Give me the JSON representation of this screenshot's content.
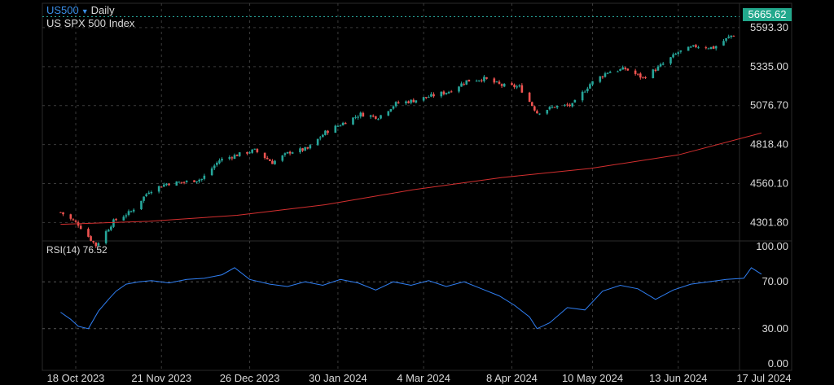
{
  "header": {
    "symbol": "US500",
    "interval": "Daily",
    "instrument_name": "US SPX 500 Index",
    "last_price": "5665.62"
  },
  "colors": {
    "background": "#000000",
    "up_candle": "#26a69a",
    "down_candle": "#ef5350",
    "moving_average": "#d32f2f",
    "rsi_line": "#2f7ef2",
    "last_price_badge": "#22a88c",
    "symbol_text": "#3a8ee6"
  },
  "chart_data": [
    {
      "type": "candlestick",
      "title": "US SPX 500 Index",
      "y_ticks": [
        "5593.30",
        "5335.00",
        "5076.70",
        "4818.40",
        "4560.10",
        "4301.80"
      ],
      "ylim": [
        4180,
        5690
      ],
      "x_ticks": [
        "18 Oct 2023",
        "21 Nov 2023",
        "26 Dec 2023",
        "30 Jan 2024",
        "4 Mar 2024",
        "8 Apr 2024",
        "10 May 2024",
        "13 Jun 2024",
        "17 Jul 2024"
      ],
      "x_dates": [
        "2023-10-18",
        "2023-11-21",
        "2023-12-26",
        "2024-01-30",
        "2024-03-04",
        "2024-04-08",
        "2024-05-10",
        "2024-06-13",
        "2024-07-17"
      ],
      "last_price": 5665.62,
      "grid": true,
      "close_series": {
        "dates": [
          "2023-10-12",
          "2023-10-19",
          "2023-10-26",
          "2023-11-02",
          "2023-11-09",
          "2023-11-16",
          "2023-11-23",
          "2023-11-30",
          "2023-12-07",
          "2023-12-14",
          "2023-12-21",
          "2023-12-28",
          "2024-01-04",
          "2024-01-11",
          "2024-01-18",
          "2024-01-25",
          "2024-02-01",
          "2024-02-08",
          "2024-02-15",
          "2024-02-22",
          "2024-02-29",
          "2024-03-07",
          "2024-03-14",
          "2024-03-21",
          "2024-03-28",
          "2024-04-04",
          "2024-04-11",
          "2024-04-18",
          "2024-04-25",
          "2024-05-02",
          "2024-05-09",
          "2024-05-16",
          "2024-05-23",
          "2024-05-30",
          "2024-06-06",
          "2024-06-13",
          "2024-06-20",
          "2024-06-27",
          "2024-07-04",
          "2024-07-11",
          "2024-07-16"
        ],
        "values": [
          4370,
          4290,
          4150,
          4310,
          4375,
          4510,
          4560,
          4570,
          4590,
          4715,
          4750,
          4780,
          4700,
          4770,
          4790,
          4900,
          4960,
          5020,
          5000,
          5090,
          5110,
          5140,
          5170,
          5240,
          5255,
          5210,
          5200,
          5030,
          5070,
          5080,
          5220,
          5300,
          5320,
          5260,
          5340,
          5430,
          5470,
          5460,
          5540,
          5580,
          5665
        ]
      },
      "moving_average": {
        "dates": [
          "2023-10-12",
          "2023-11-16",
          "2023-12-21",
          "2024-01-25",
          "2024-02-29",
          "2024-04-04",
          "2024-05-09",
          "2024-06-13",
          "2024-07-16"
        ],
        "values": [
          4290,
          4310,
          4350,
          4420,
          4520,
          4600,
          4660,
          4750,
          4895
        ]
      }
    },
    {
      "type": "line",
      "title": "RSI(14) 76.52",
      "series": [
        {
          "name": "RSI(14)",
          "dates": [
            "2023-10-12",
            "2023-10-16",
            "2023-10-19",
            "2023-10-23",
            "2023-10-27",
            "2023-10-31",
            "2023-11-03",
            "2023-11-07",
            "2023-11-12",
            "2023-11-17",
            "2023-11-24",
            "2023-12-01",
            "2023-12-08",
            "2023-12-15",
            "2023-12-20",
            "2023-12-26",
            "2024-01-03",
            "2024-01-10",
            "2024-01-17",
            "2024-01-24",
            "2024-01-31",
            "2024-02-07",
            "2024-02-14",
            "2024-02-21",
            "2024-02-28",
            "2024-03-06",
            "2024-03-13",
            "2024-03-20",
            "2024-03-27",
            "2024-04-03",
            "2024-04-09",
            "2024-04-15",
            "2024-04-18",
            "2024-04-23",
            "2024-04-30",
            "2024-05-07",
            "2024-05-14",
            "2024-05-21",
            "2024-05-28",
            "2024-06-04",
            "2024-06-11",
            "2024-06-18",
            "2024-06-25",
            "2024-07-02",
            "2024-07-09",
            "2024-07-12",
            "2024-07-16"
          ],
          "values": [
            44,
            38,
            32,
            30,
            45,
            55,
            62,
            68,
            70,
            71,
            69,
            72,
            73,
            76,
            82,
            72,
            68,
            66,
            70,
            67,
            72,
            69,
            63,
            70,
            67,
            71,
            66,
            70,
            64,
            58,
            50,
            40,
            30,
            35,
            48,
            46,
            62,
            67,
            64,
            55,
            63,
            68,
            70,
            72,
            73,
            82,
            76.52
          ]
        }
      ],
      "y_ticks": [
        "100.00",
        "70.00",
        "30.00",
        "0.00"
      ],
      "ylim": [
        0,
        100
      ],
      "ref_lines": [
        70,
        30
      ],
      "x_ticks": [
        "18 Oct 2023",
        "21 Nov 2023",
        "26 Dec 2023",
        "30 Jan 2024",
        "4 Mar 2024",
        "8 Apr 2024",
        "10 May 2024",
        "13 Jun 2024",
        "17 Jul 2024"
      ]
    }
  ]
}
